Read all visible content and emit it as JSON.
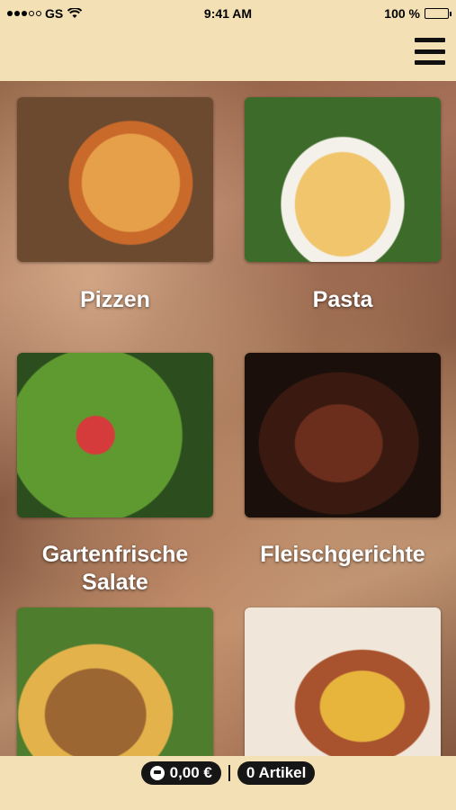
{
  "status": {
    "carrier": "GS",
    "time": "9:41 AM",
    "battery": "100 %"
  },
  "menu": {
    "icon": "hamburger-icon"
  },
  "categories": [
    {
      "label": "Pizzen",
      "image": "pizza-photo"
    },
    {
      "label": "Pasta",
      "image": "pasta-photo"
    },
    {
      "label": "Gartenfrische Salate",
      "image": "salad-photo"
    },
    {
      "label": "Fleischgerichte",
      "image": "steak-photo"
    },
    {
      "label": "",
      "image": "kebab-fries-photo"
    },
    {
      "label": "",
      "image": "tacos-photo"
    }
  ],
  "cart": {
    "total": "0,00 €",
    "items": "0 Artikel"
  }
}
